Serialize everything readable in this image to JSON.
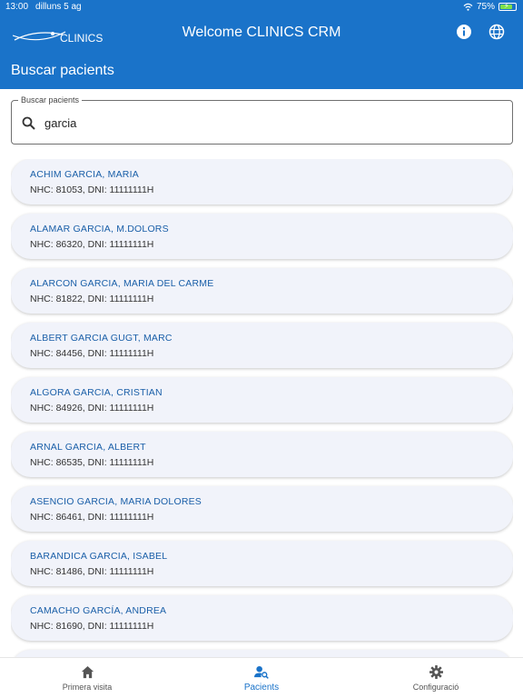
{
  "statusbar": {
    "time": "13:00",
    "date": "dilluns 5 ag",
    "battery": "75%"
  },
  "header": {
    "logo_text": "CLINICS",
    "title": "Welcome CLINICS CRM"
  },
  "page": {
    "title": "Buscar pacients"
  },
  "search": {
    "label": "Buscar pacients",
    "value": "garcia"
  },
  "patients": [
    {
      "name": "ACHIM GARCIA, MARIA",
      "meta": "NHC: 81053, DNI: 11111111H"
    },
    {
      "name": "ALAMAR GARCIA, M.DOLORS",
      "meta": "NHC: 86320, DNI: 11111111H"
    },
    {
      "name": "ALARCON GARCIA, MARIA  DEL CARME",
      "meta": "NHC: 81822, DNI: 11111111H"
    },
    {
      "name": "ALBERT GARCIA GUGT, MARC",
      "meta": "NHC: 84456, DNI: 11111111H"
    },
    {
      "name": "ALGORA GARCIA, CRISTIAN",
      "meta": "NHC: 84926, DNI: 11111111H"
    },
    {
      "name": "ARNAL GARCIA, ALBERT",
      "meta": "NHC: 86535, DNI: 11111111H"
    },
    {
      "name": "ASENCIO GARCIA, MARIA DOLORES",
      "meta": "NHC: 86461, DNI: 11111111H"
    },
    {
      "name": "BARANDICA GARCIA, ISABEL",
      "meta": "NHC: 81486, DNI: 11111111H"
    },
    {
      "name": "CAMACHO GARCÍA, ANDREA",
      "meta": "NHC: 81690, DNI: 11111111H"
    },
    {
      "name": "",
      "meta": ""
    }
  ],
  "nav": {
    "items": [
      {
        "label": "Primera visita",
        "icon": "home-icon"
      },
      {
        "label": "Pacients",
        "icon": "patient-search-icon",
        "active": true
      },
      {
        "label": "Configuració",
        "icon": "gear-icon"
      }
    ]
  },
  "colors": {
    "primary": "#1a73c9",
    "card_bg": "#f1f3fa",
    "name_text": "#1a5fa8"
  }
}
